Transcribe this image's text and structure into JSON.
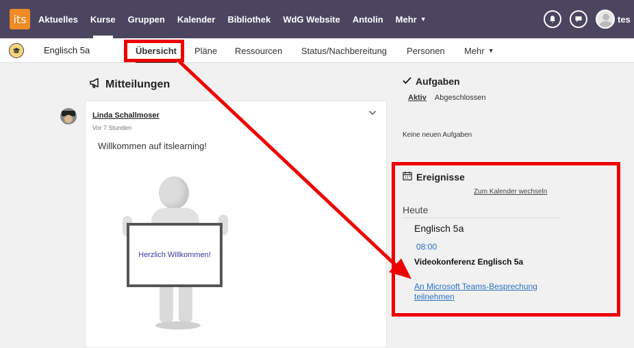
{
  "topnav": {
    "logo": "its",
    "items": [
      {
        "label": "Aktuelles"
      },
      {
        "label": "Kurse"
      },
      {
        "label": "Gruppen"
      },
      {
        "label": "Kalender"
      },
      {
        "label": "Bibliothek"
      },
      {
        "label": "WdG Website"
      },
      {
        "label": "Antolin"
      },
      {
        "label": "Mehr"
      }
    ],
    "user_name": "tes"
  },
  "course": {
    "name": "Englisch 5a",
    "tabs": [
      {
        "label": "Übersicht"
      },
      {
        "label": "Pläne"
      },
      {
        "label": "Ressourcen"
      },
      {
        "label": "Status/Nachbereitung"
      },
      {
        "label": "Personen"
      },
      {
        "label": "Mehr"
      }
    ]
  },
  "announcements": {
    "title": "Mitteilungen",
    "post": {
      "author": "Linda Schallmoser",
      "time": "Vor 7 Stunden",
      "text": "Willkommen auf itslearning!",
      "sign_text": "Herzlich Willkommen!"
    }
  },
  "tasks": {
    "title": "Aufgaben",
    "tabs": [
      {
        "label": "Aktiv"
      },
      {
        "label": "Abgeschlossen"
      }
    ],
    "empty_text": "Keine neuen Aufgaben"
  },
  "events": {
    "title": "Ereignisse",
    "calendar_link": "Zum Kalender wechseln",
    "today_label": "Heute",
    "event": {
      "course": "Englisch 5a",
      "time": "08:00",
      "title": "Videokonferenz Englisch 5a",
      "link": "An Microsoft Teams-Besprechung teilnehmen"
    }
  },
  "colors": {
    "topnav_bg": "#4b4560",
    "logo_orange": "#f08a24",
    "highlight_red": "#e00000",
    "link_blue": "#2a6fc4"
  }
}
